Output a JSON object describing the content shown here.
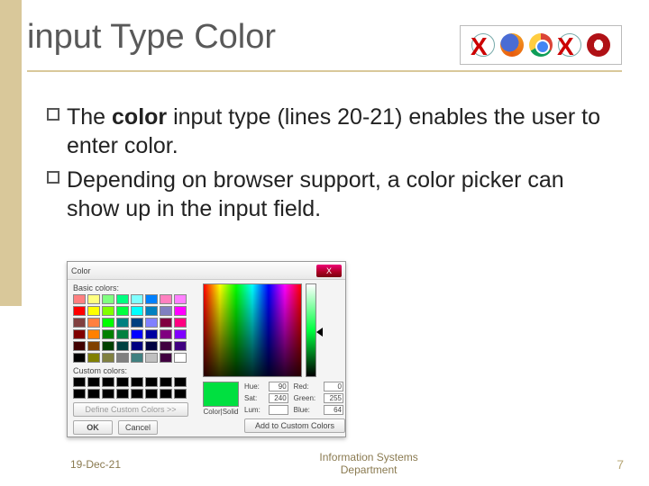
{
  "title": "input Type Color",
  "browser_icons": [
    "ie-icon",
    "firefox-icon",
    "chrome-icon",
    "safari-icon",
    "opera-icon"
  ],
  "bullets": [
    {
      "pre": "The ",
      "bold": "color",
      "post": " input type (lines 20-21) enables the user to enter color."
    },
    {
      "pre": "Depending on browser support, a color picker can show up in the input field.",
      "bold": "",
      "post": ""
    }
  ],
  "color_dialog": {
    "title": "Color",
    "close": "X",
    "basic_label": "Basic colors:",
    "basic_swatches": [
      "#ff8080",
      "#ffff80",
      "#80ff80",
      "#00ff80",
      "#80ffff",
      "#0080ff",
      "#ff80c0",
      "#ff80ff",
      "#ff0000",
      "#ffff00",
      "#80ff00",
      "#00ff40",
      "#00ffff",
      "#0080c0",
      "#8080c0",
      "#ff00ff",
      "#804040",
      "#ff8040",
      "#00ff00",
      "#008080",
      "#004080",
      "#8080ff",
      "#800040",
      "#ff0080",
      "#800000",
      "#ff8000",
      "#008000",
      "#008040",
      "#0000ff",
      "#0000a0",
      "#800080",
      "#8000ff",
      "#400000",
      "#804000",
      "#004000",
      "#004040",
      "#000080",
      "#000040",
      "#400040",
      "#400080",
      "#000000",
      "#808000",
      "#808040",
      "#808080",
      "#408080",
      "#c0c0c0",
      "#400040",
      "#ffffff"
    ],
    "custom_label": "Custom colors:",
    "define_btn": "Define Custom Colors >>",
    "ok": "OK",
    "cancel": "Cancel",
    "color_solid": "Color|Solid",
    "add_btn": "Add to Custom Colors",
    "fields": {
      "hue_label": "Hue:",
      "hue": "90",
      "sat_label": "Sat:",
      "sat": "240",
      "lum_label": "Lum:",
      "lum": "",
      "red_label": "Red:",
      "red": "0",
      "green_label": "Green:",
      "green": "255",
      "blue_label": "Blue:",
      "blue": "64"
    }
  },
  "footer": {
    "date": "19-Dec-21",
    "center_line1": "Information Systems",
    "center_line2": "Department",
    "page": "7"
  }
}
